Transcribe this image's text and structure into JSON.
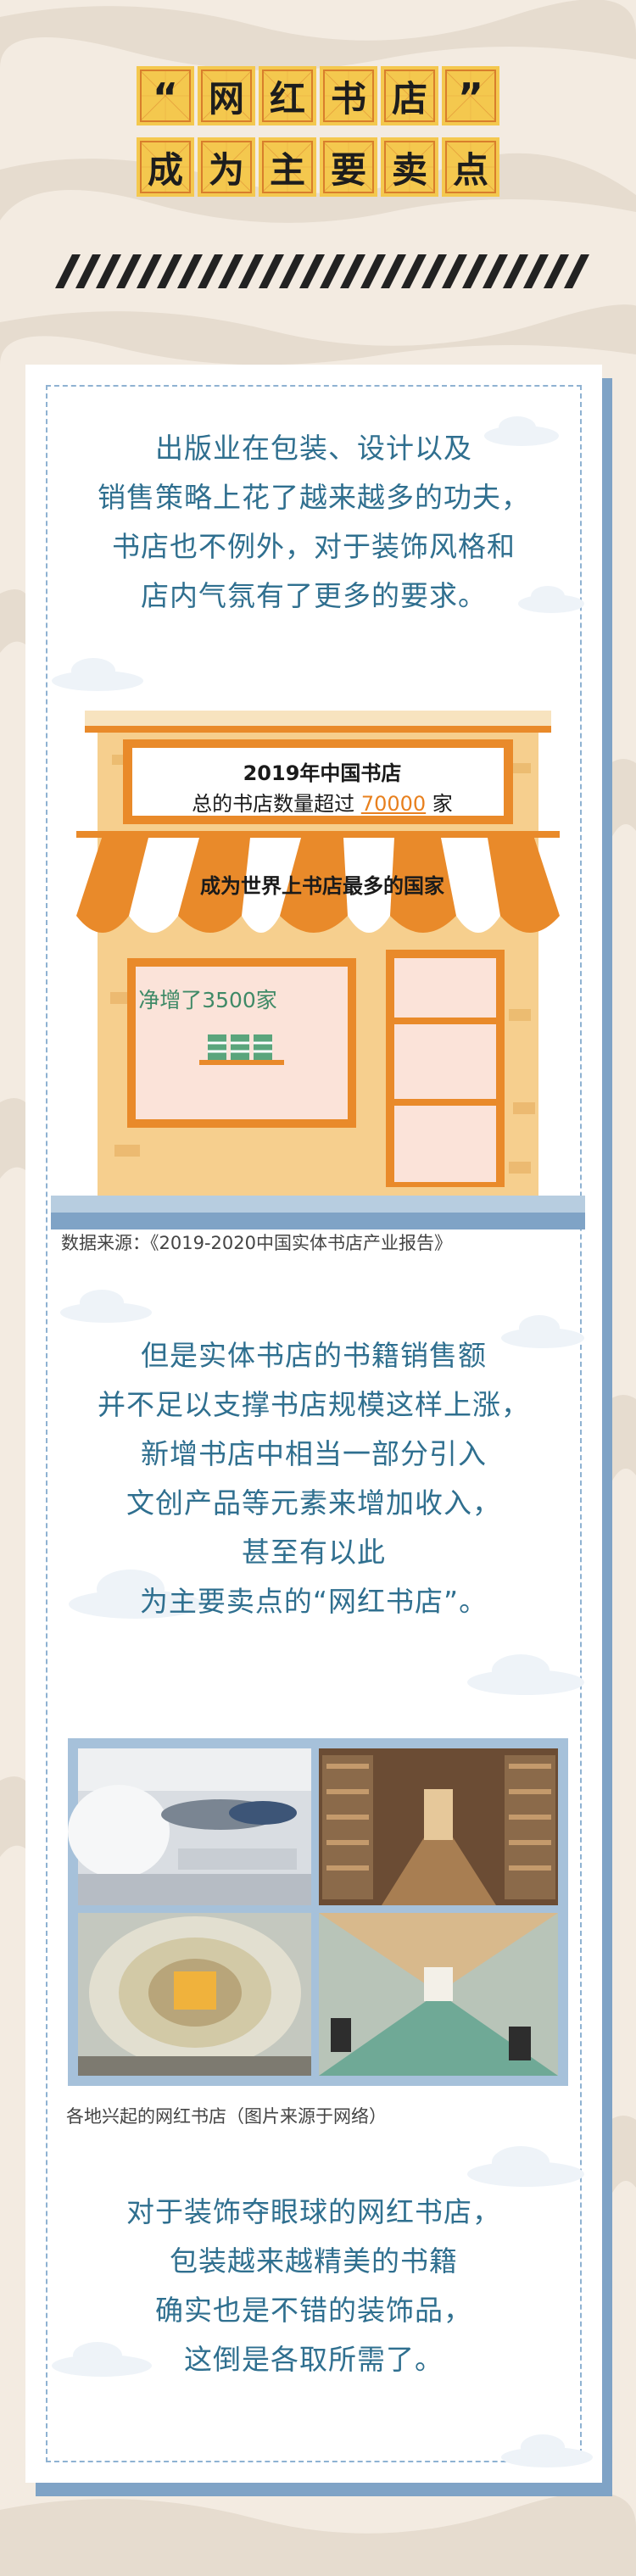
{
  "title": {
    "line1": [
      "“",
      "网",
      "红",
      "书",
      "店",
      "”"
    ],
    "line2": [
      "成",
      "为",
      "主",
      "要",
      "卖",
      "点"
    ]
  },
  "intro": [
    "出版业在包装、设计以及",
    "销售策略上花了越来越多的功夫，",
    "书店也不例外，对于装饰风格和",
    "店内气氛有了更多的要求。"
  ],
  "shop": {
    "sign_line1": "2019年中国书店",
    "sign_line2_prefix": "总的书店数量超过 ",
    "sign_number": "70000",
    "sign_line2_suffix": " 家",
    "awning_text": "成为世界上书店最多的国家",
    "window_text": "净增了3500家"
  },
  "source_caption": "数据来源：《2019-2020中国实体书店产业报告》",
  "middle": [
    "但是实体书店的书籍销售额",
    "并不足以支撑书店规模这样上涨，",
    "新增书店中相当一部分引入",
    "文创产品等元素来增加收入，",
    "甚至有以此",
    "为主要卖点的“网红书店”。"
  ],
  "photo_caption": "各地兴起的网红书店（图片来源于网络）",
  "closing": [
    "对于装饰夺眼球的网红书店，",
    "包装越来越精美的书籍",
    "确实也是不错的装饰品，",
    "这倒是各取所需了。"
  ],
  "colors": {
    "text_blue": "#2f6f8f",
    "title_tile": "#f4c84e",
    "accent_orange": "#e8801e",
    "card_shadow": "#7fa3c6"
  }
}
